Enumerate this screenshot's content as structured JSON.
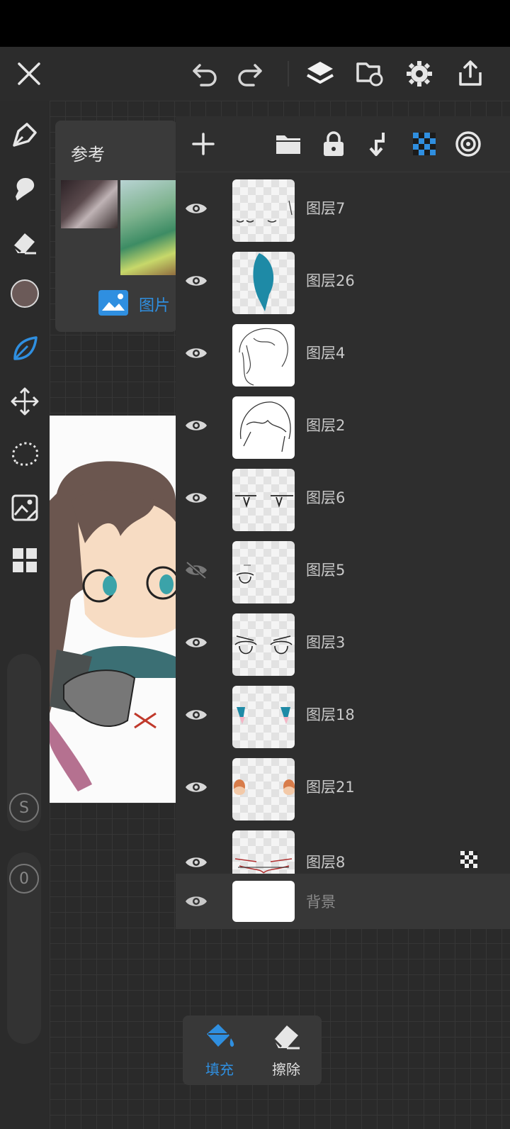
{
  "reference": {
    "title": "参考",
    "picture_label": "图片"
  },
  "layers": [
    {
      "name": "图层7",
      "visible": true
    },
    {
      "name": "图层26",
      "visible": true
    },
    {
      "name": "图层4",
      "visible": true
    },
    {
      "name": "图层2",
      "visible": true
    },
    {
      "name": "图层6",
      "visible": true
    },
    {
      "name": "图层5",
      "visible": false
    },
    {
      "name": "图层3",
      "visible": true
    },
    {
      "name": "图层18",
      "visible": true
    },
    {
      "name": "图层21",
      "visible": true
    },
    {
      "name": "图层8",
      "visible": true
    }
  ],
  "background_layer": {
    "name": "背景"
  },
  "slider": {
    "size_label": "S",
    "opacity_label": "0"
  },
  "fill_popup": {
    "fill_label": "填充",
    "erase_label": "擦除"
  },
  "colors": {
    "accent": "#2f8fe0",
    "current_color": "#6b5a58"
  }
}
